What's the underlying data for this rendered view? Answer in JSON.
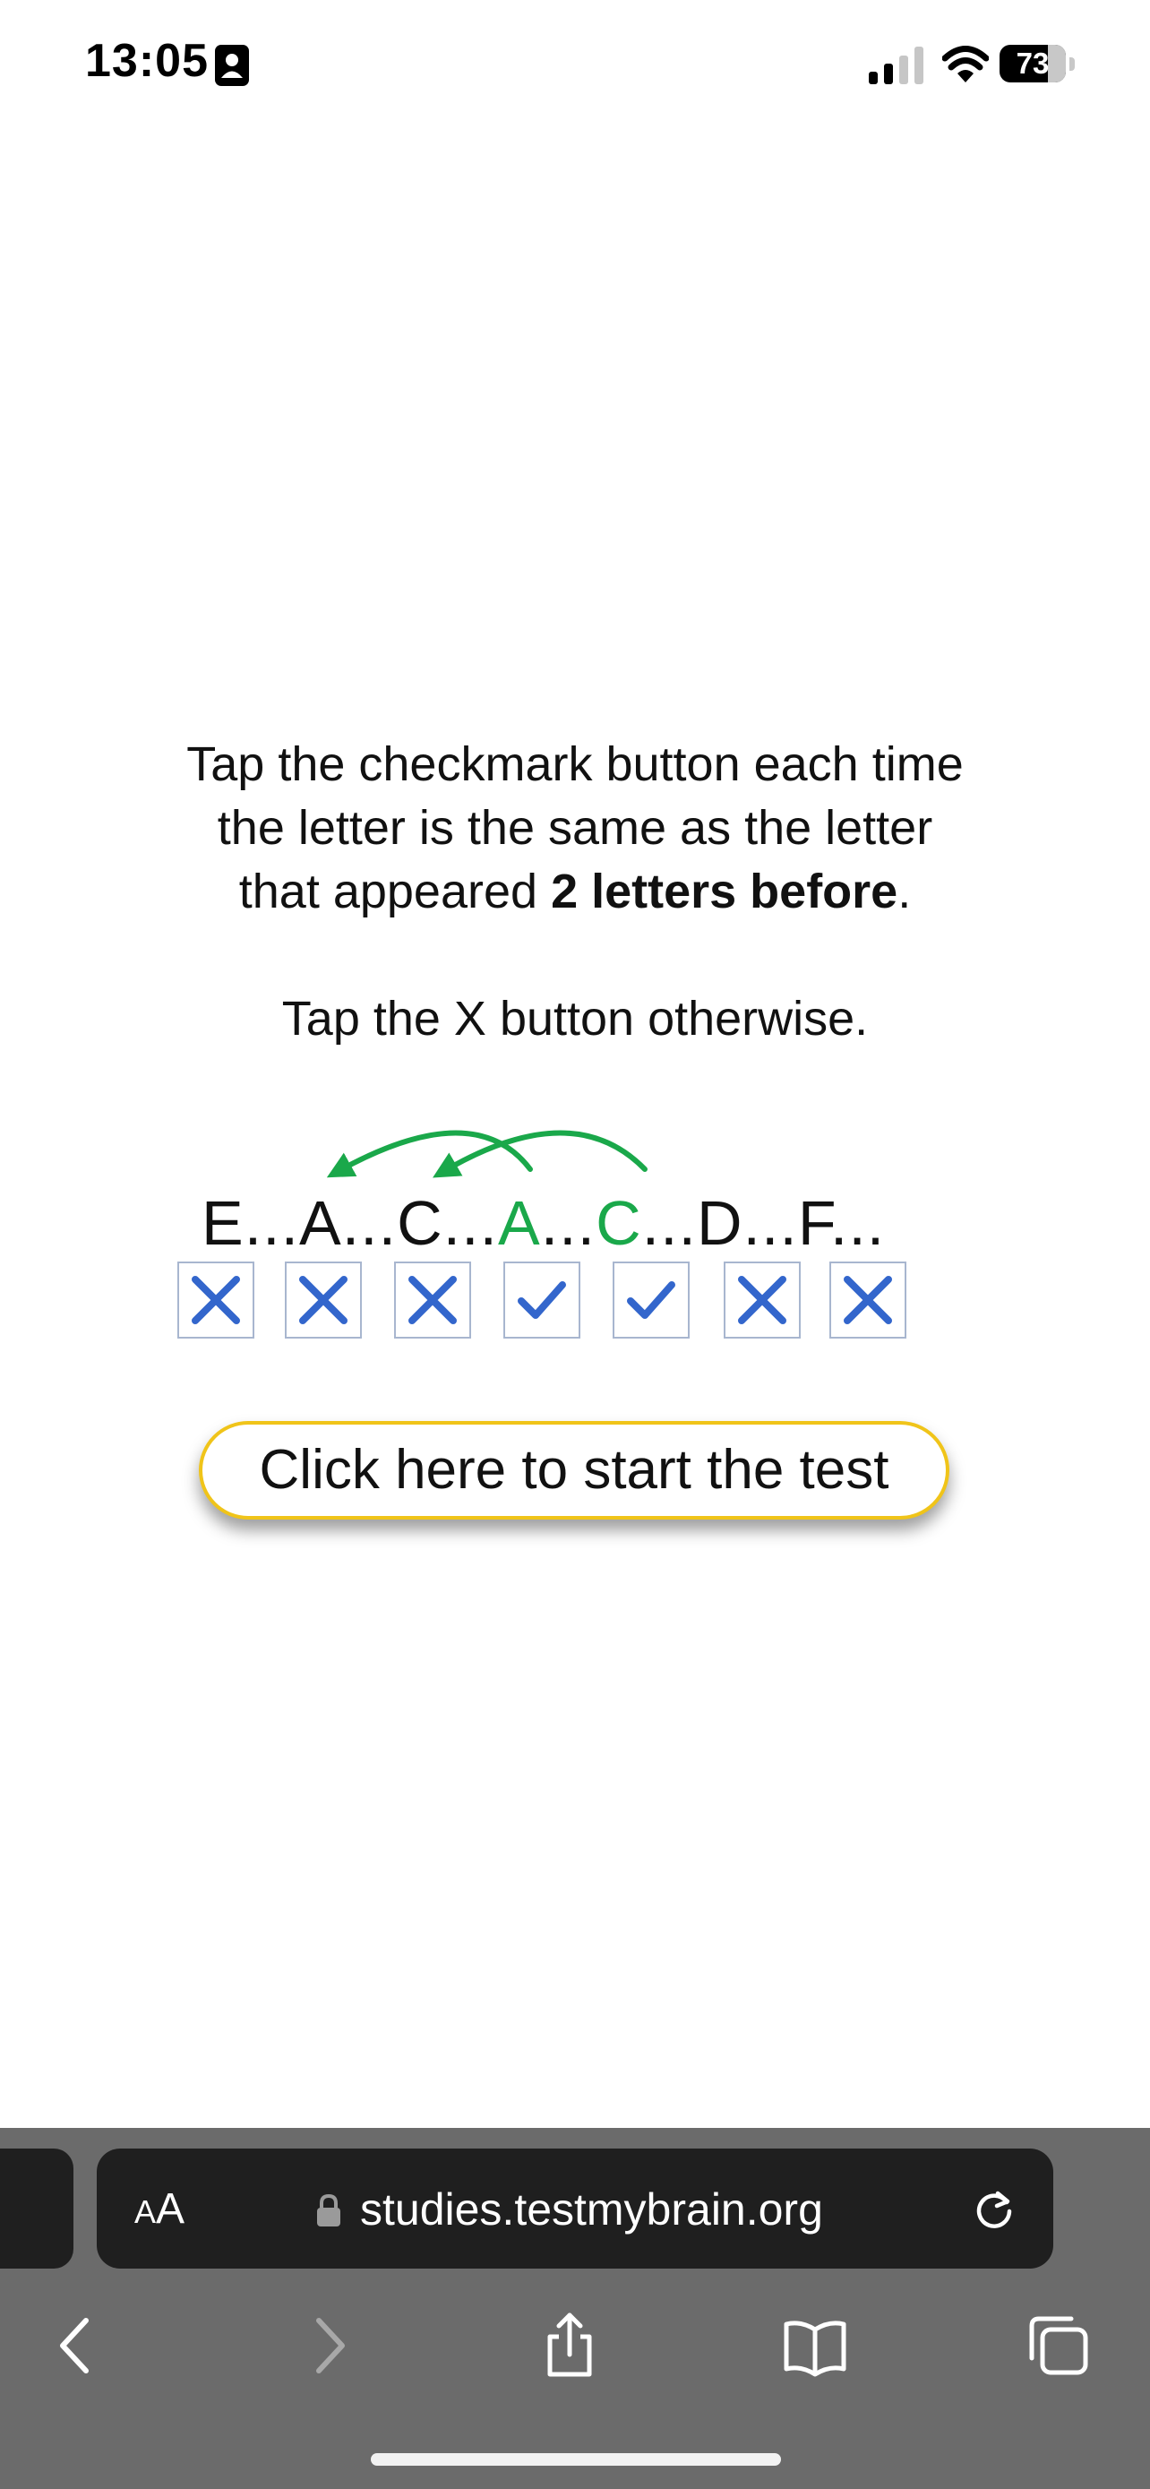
{
  "status_bar": {
    "time": "13:05",
    "battery_level": "73",
    "icons": [
      "contact-card-icon",
      "cellular-signal-icon",
      "wifi-icon",
      "battery-icon"
    ]
  },
  "instructions": {
    "line1": "Tap the checkmark button each time",
    "line2": "the letter is the same as the letter",
    "line3_prefix": "that appeared ",
    "line3_bold": "2 letters before",
    "line3_suffix": ".",
    "otherwise": "Tap the X button otherwise."
  },
  "example": {
    "letters": [
      {
        "text": "E...",
        "highlight": false
      },
      {
        "text": "A...",
        "highlight": false
      },
      {
        "text": "C...",
        "highlight": false
      },
      {
        "text": "A",
        "highlight": true
      },
      {
        "text": "...",
        "highlight": false
      },
      {
        "text": "C",
        "highlight": true
      },
      {
        "text": "...D...F...",
        "highlight": false
      }
    ],
    "answers": [
      "x",
      "x",
      "x",
      "check",
      "check",
      "x",
      "x"
    ],
    "colors": {
      "highlight": "#1aa84a",
      "mark": "#3366cc",
      "box_border": "#a8b6cf",
      "arrow": "#1aa84a"
    }
  },
  "start_button": {
    "label": "Click here to start the test",
    "border_color": "#f0c419"
  },
  "browser": {
    "aa_small": "A",
    "aa_big": "A",
    "url": "studies.testmybrain.org",
    "icons": [
      "lock-icon",
      "reload-icon",
      "back-icon",
      "forward-icon",
      "share-icon",
      "bookmarks-icon",
      "tabs-icon"
    ]
  }
}
